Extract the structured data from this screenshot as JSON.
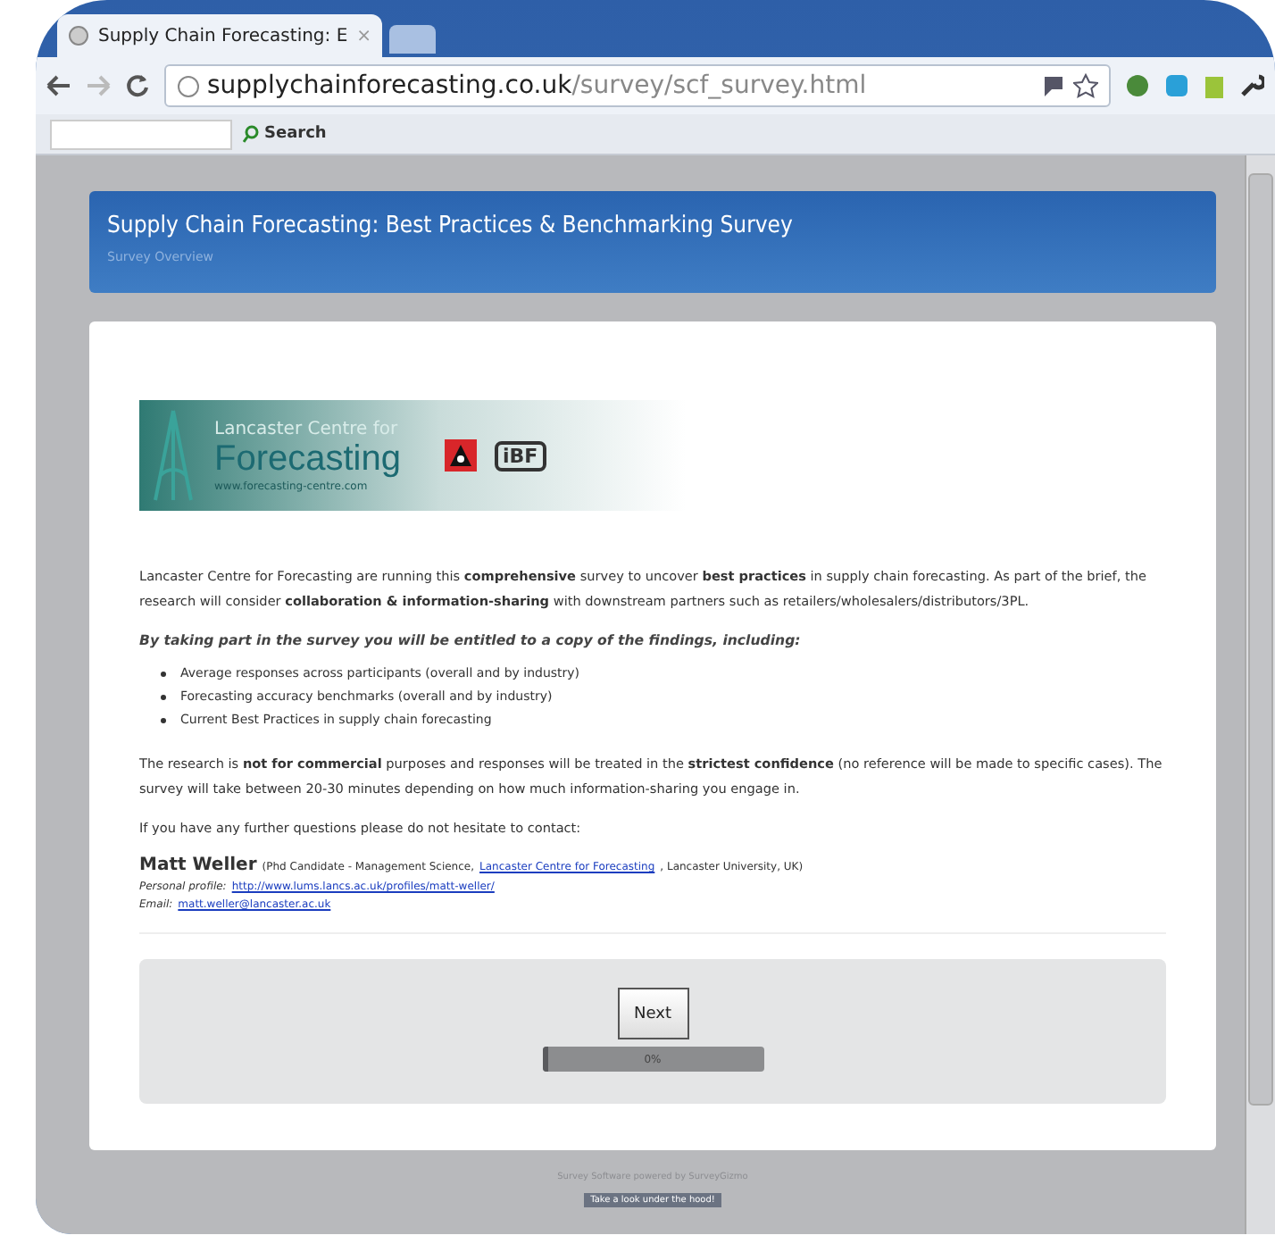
{
  "browser": {
    "tab": {
      "title": "Supply Chain Forecasting: E",
      "close": "×"
    },
    "url": {
      "host": "supplychainforecasting.co.uk",
      "path": "/survey/scf_survey.html"
    },
    "toolbar": {
      "search": "Search"
    }
  },
  "header": {
    "title": "Supply Chain Forecasting: Best Practices & Benchmarking Survey",
    "subtitle": "Survey Overview"
  },
  "logo": {
    "line1": "Lancaster Centre for",
    "line2": "Forecasting",
    "site": "www.forecasting-centre.com",
    "badge": "iBF"
  },
  "intro": "Lancaster Centre for Forecasting are running this **comprehensive** survey to uncover **best practices** in supply chain forecasting.  As part of the brief, the research will consider **collaboration & information-sharing** with downstream partners such as retailers/wholesalers/distributors/3PL.",
  "lead": "By taking part in the survey you will be entitled to a copy of the findings, including:",
  "bullets": [
    "Average responses across participants (overall and by industry)",
    "Forecasting accuracy benchmarks (overall and by industry)",
    "Current Best Practices in supply chain forecasting"
  ],
  "notice": "The research is **not for commercial** purposes and responses will be treated in the **strictest confidence** (no reference will be made to specific cases). The survey will take between 20-30 minutes depending on how much information-sharing you engage in.",
  "contact_prompt": "If you have any further questions please do not hesitate to contact:",
  "contact": {
    "name": "Matt Weller",
    "role_before": "(Phd Candidate - Management Science,",
    "role_link": "Lancaster Centre for Forecasting",
    "role_after": ", Lancaster University, UK)",
    "profile_label": "Personal profile:",
    "profile_url": "http://www.lums.lancs.ac.uk/profiles/matt-weller/",
    "email_label": "Email:",
    "email": "matt.weller@lancaster.ac.uk"
  },
  "next_button": "Next",
  "progress": {
    "level": 0,
    "reading": "0%"
  },
  "footer": {
    "powered": "Survey Software powered by SurveyGizmo",
    "badge": "Take a look under the hood!"
  }
}
